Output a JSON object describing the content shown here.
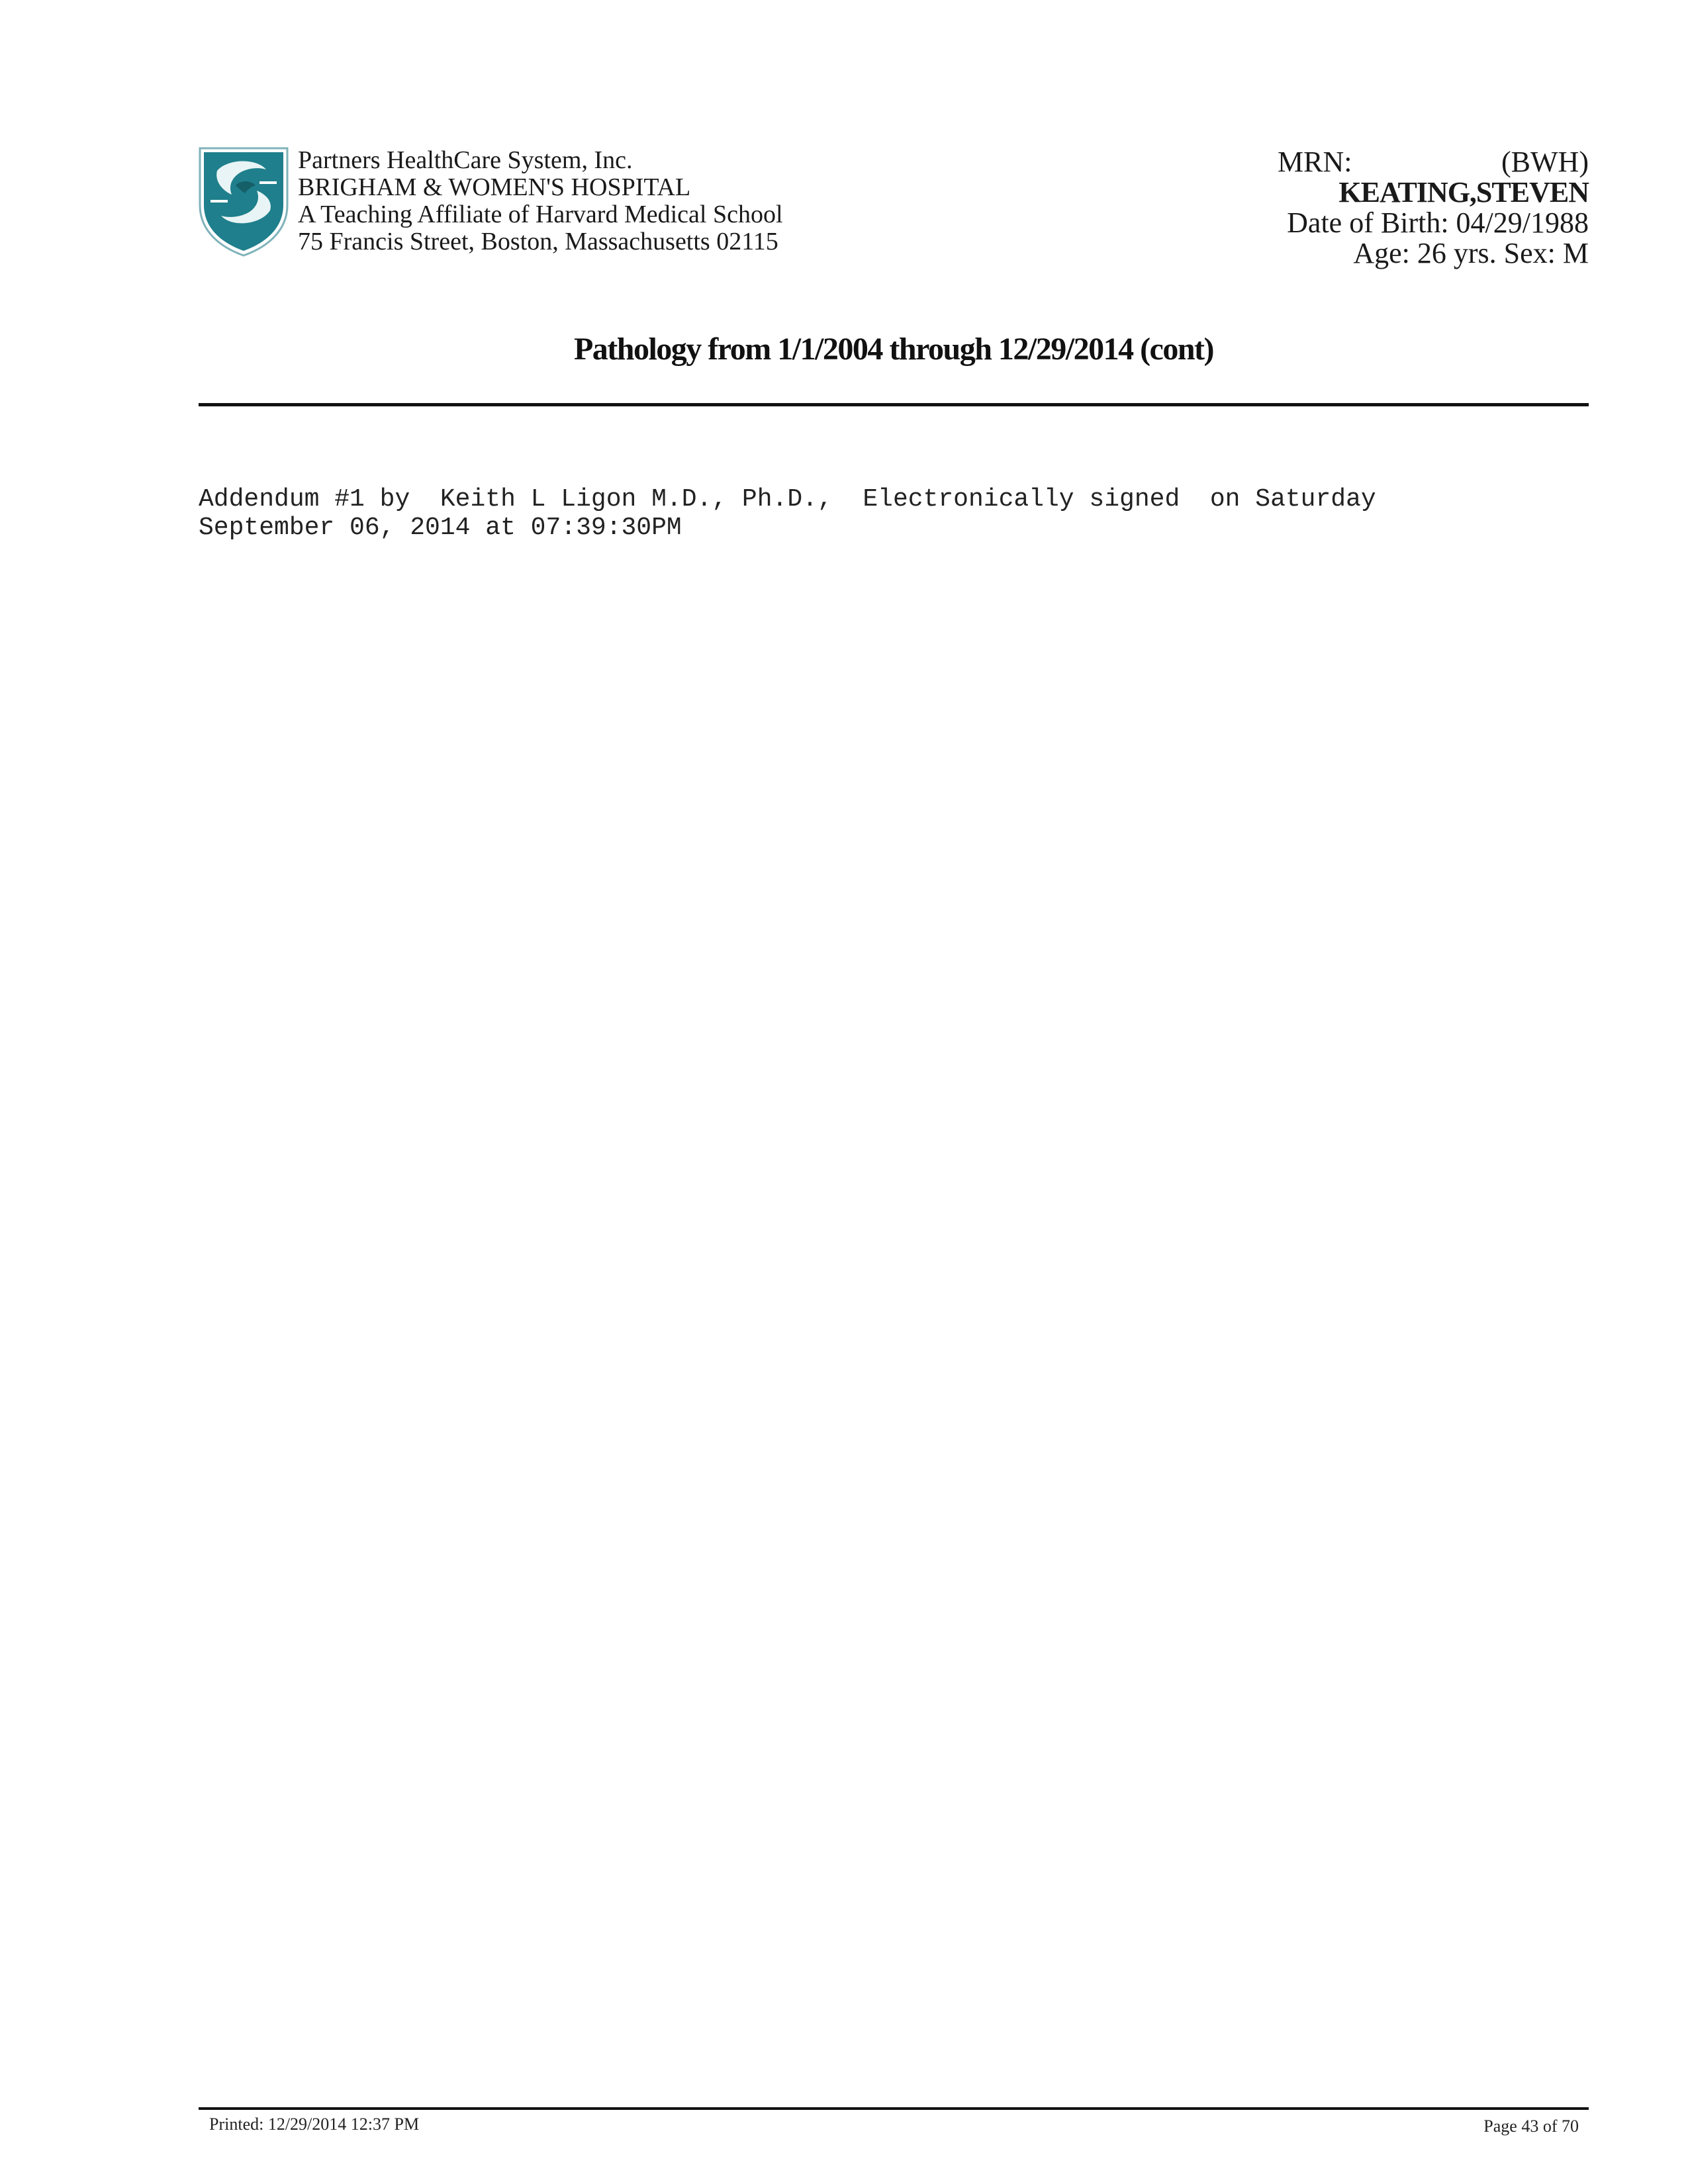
{
  "colors": {
    "logo_teal": "#1f7f8c",
    "logo_dark": "#155f69"
  },
  "header": {
    "org_lines": [
      "Partners HealthCare System, Inc.",
      "BRIGHAM & WOMEN'S HOSPITAL",
      "A Teaching Affiliate of Harvard Medical School",
      "75 Francis Street, Boston, Massachusetts 02115"
    ],
    "logo_icon": "partners-shield-icon"
  },
  "patient": {
    "mrn_label": "MRN:",
    "mrn_site": "(BWH)",
    "name": "KEATING,STEVEN",
    "dob_line": "Date of Birth: 04/29/1988",
    "age_sex_line": "Age: 26 yrs. Sex: M"
  },
  "report": {
    "title": "Pathology from 1/1/2004 through 12/29/2014 (cont)",
    "addendum_lines": [
      "Addendum #1 by  Keith L Ligon M.D., Ph.D.,  Electronically signed  on Saturday",
      "September 06, 2014 at 07:39:30PM"
    ]
  },
  "footer": {
    "printed": "Printed: 12/29/2014 12:37 PM",
    "page": "Page 43 of 70"
  }
}
